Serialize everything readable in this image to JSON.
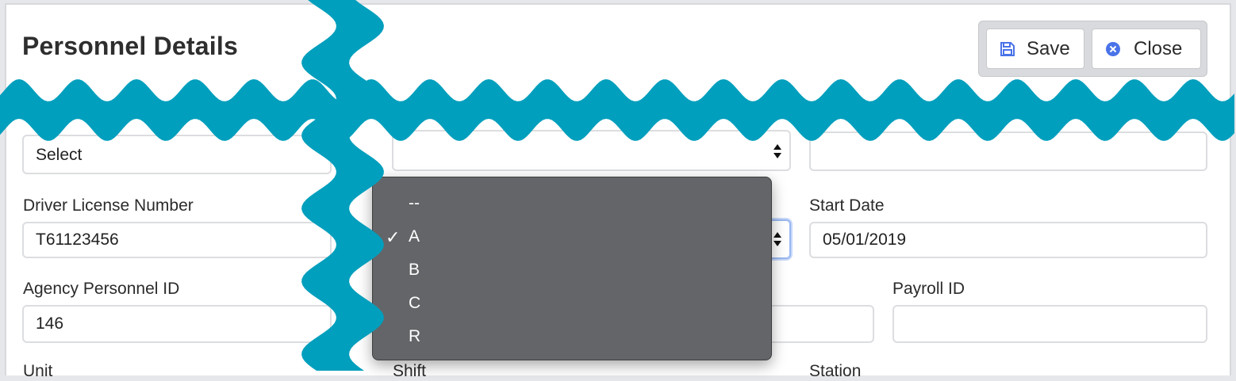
{
  "header": {
    "title": "Personnel Details",
    "save_label": "Save",
    "close_label": "Close"
  },
  "row1": {
    "select_value": "Select"
  },
  "row2": {
    "driver_license_label": "Driver License Number",
    "driver_license_value": "T61123456",
    "start_date_label": "Start Date",
    "start_date_value": "05/01/2019"
  },
  "row3": {
    "agency_personnel_id_label": "Agency Personnel ID",
    "agency_personnel_id_value": "146",
    "payroll_id_label": "Payroll ID",
    "payroll_id_value": ""
  },
  "row4": {
    "unit_label": "Unit",
    "shift_label": "Shift",
    "station_label": "Station"
  },
  "dropdown": {
    "options": [
      "--",
      "A",
      "B",
      "C",
      "R"
    ],
    "selected": "A"
  },
  "colors": {
    "accent": "#4a73e8",
    "wave": "#009fbd",
    "dropdown_bg": "#646568"
  }
}
